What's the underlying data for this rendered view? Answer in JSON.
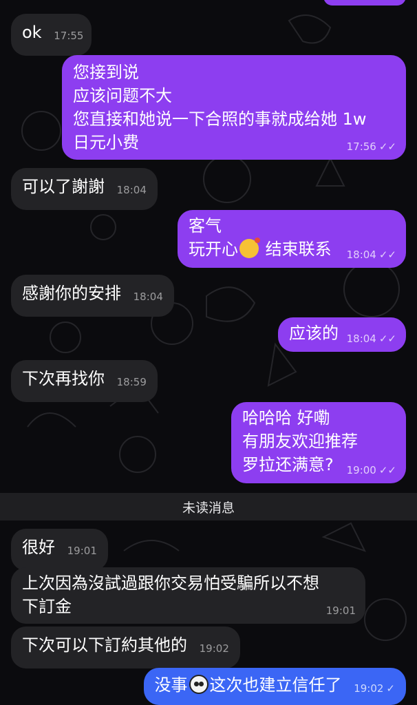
{
  "messages": [
    {
      "text": "ok",
      "time": "17:55"
    },
    {
      "text": "您接到说\n应该问题不大\n您直接和她说一下合照的事就成给她 1w\n日元小费",
      "time": "17:56"
    },
    {
      "text": "可以了謝謝",
      "time": "18:04"
    },
    {
      "line1": "客气",
      "line2a": "玩开心",
      "line2b": " 结束联系",
      "emoji": "party-face",
      "time": "18:04"
    },
    {
      "text": "感謝你的安排",
      "time": "18:04"
    },
    {
      "text": "应该的",
      "time": "18:04"
    },
    {
      "text": "下次再找你",
      "time": "18:59"
    },
    {
      "text": "哈哈哈 好嘞\n有朋友欢迎推荐\n罗拉还满意?",
      "time": "19:00"
    },
    {
      "text": "很好",
      "time": "19:01"
    },
    {
      "text": "上次因為沒試過跟你交易怕受騙所以不想\n下訂金",
      "time": "19:01"
    },
    {
      "text": "下次可以下訂約其他的",
      "time": "19:02"
    },
    {
      "part1": "没事",
      "part2": "这次也建立信任了",
      "emoji": "panda-face",
      "time": "19:02"
    }
  ],
  "unread_divider": "未读消息",
  "colors": {
    "outgoing": "#8d3ef0",
    "outgoing_last": "#3b66f5",
    "incoming": "#232326",
    "background": "#0b0b0e"
  }
}
